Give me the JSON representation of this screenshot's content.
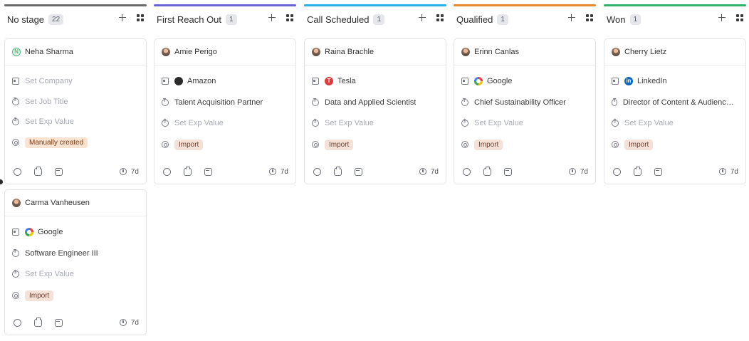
{
  "board": {
    "columns": [
      {
        "title": "No stage",
        "count": "22",
        "color": "#6b6b6b"
      },
      {
        "title": "First Reach Out",
        "count": "1",
        "color": "#6a63d8"
      },
      {
        "title": "Call Scheduled",
        "count": "1",
        "color": "#2bb1e8"
      },
      {
        "title": "Qualified",
        "count": "1",
        "color": "#e8892e"
      },
      {
        "title": "Won",
        "count": "1",
        "color": "#2fb36b"
      }
    ],
    "cards": [
      {
        "name": "Neha Sharma",
        "avatar": "N",
        "company": "Set Company",
        "company_logo": "",
        "title": "Set Job Title",
        "value": "Set Exp Value",
        "source": "Manually created",
        "age": "7d"
      },
      {
        "name": "Amie Perigo",
        "company": "Amazon",
        "company_logo": "amazon",
        "title": "Talent Acquisition Partner",
        "value": "Set Exp Value",
        "source": "Import",
        "age": "7d"
      },
      {
        "name": "Raina Brachle",
        "company": "Tesla",
        "company_logo": "tesla",
        "title": "Data and Applied Scientist",
        "value": "Set Exp Value",
        "source": "Import",
        "age": "7d"
      },
      {
        "name": "Erinn Canlas",
        "company": "Google",
        "company_logo": "google",
        "title": "Chief Sustainability Officer",
        "value": "Set Exp Value",
        "source": "Import",
        "age": "7d"
      },
      {
        "name": "Cherry Lietz",
        "company": "LinkedIn",
        "company_logo": "linkedin",
        "title": "Director of Content & Audience Development",
        "value": "Set Exp Value",
        "source": "Import",
        "age": "7d"
      },
      {
        "name": "Carma Vanheusen",
        "company": "Google",
        "company_logo": "google",
        "title": "Software Engineer III",
        "value": "Set Exp Value",
        "source": "Import",
        "age": "7d"
      }
    ],
    "logo_glyphs": {
      "tesla": "T",
      "linkedin": "in",
      "amazon": ""
    }
  }
}
